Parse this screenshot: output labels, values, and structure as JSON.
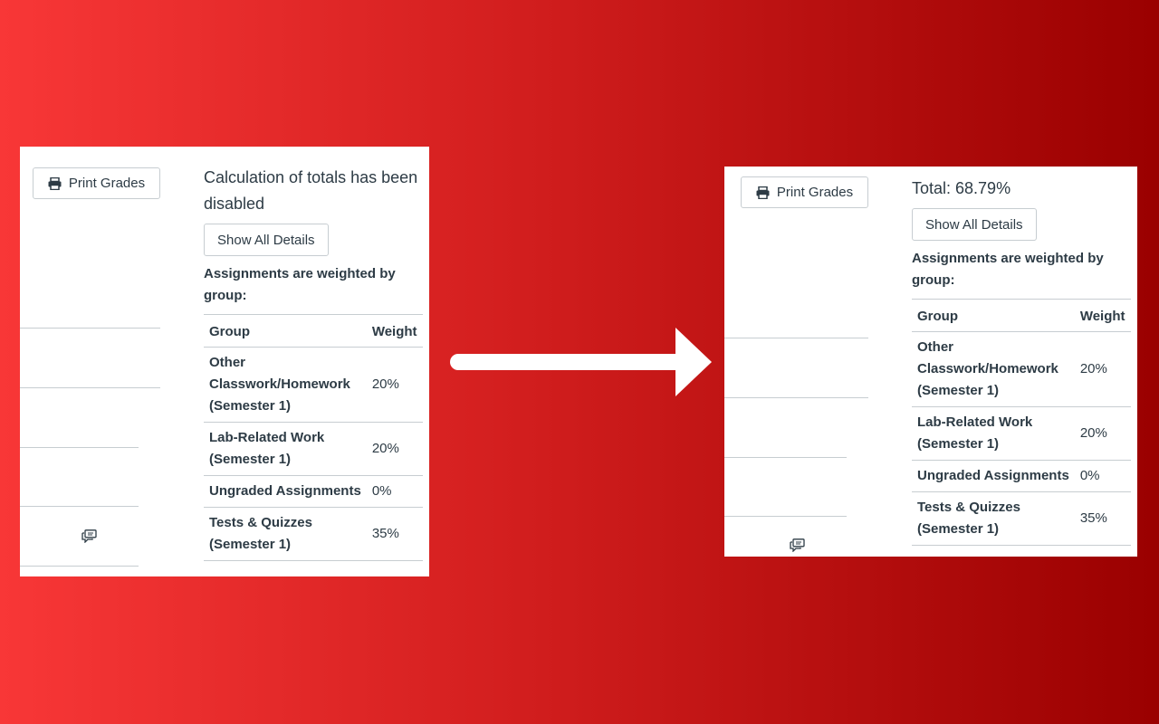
{
  "before": {
    "print_label": "Print Grades",
    "status": "Calculation of totals has been disabled",
    "details_label": "Show All Details",
    "weighted_note": "Assignments are weighted by group:",
    "headers": {
      "group": "Group",
      "weight": "Weight"
    },
    "rows": [
      {
        "group": "Other Classwork/Homework (Semester 1)",
        "weight": "20%"
      },
      {
        "group": "Lab-Related Work (Semester 1)",
        "weight": "20%"
      },
      {
        "group": "Ungraded Assignments",
        "weight": "0%"
      },
      {
        "group": "Tests & Quizzes (Semester 1)",
        "weight": "35%"
      }
    ]
  },
  "after": {
    "print_label": "Print Grades",
    "status": "Total: 68.79%",
    "details_label": "Show All Details",
    "weighted_note": "Assignments are weighted by group:",
    "headers": {
      "group": "Group",
      "weight": "Weight"
    },
    "rows": [
      {
        "group": "Other Classwork/Homework (Semester 1)",
        "weight": "20%"
      },
      {
        "group": "Lab-Related Work (Semester 1)",
        "weight": "20%"
      },
      {
        "group": "Ungraded Assignments",
        "weight": "0%"
      },
      {
        "group": "Tests & Quizzes (Semester 1)",
        "weight": "35%"
      }
    ]
  },
  "icons": {
    "print": "printer-icon",
    "chat": "chat-icon",
    "transition": "right-arrow-icon"
  },
  "colors": {
    "background_start": "#f83737",
    "background_end": "#9a0000",
    "text": "#2d3b45",
    "border": "#c7cdd1"
  }
}
